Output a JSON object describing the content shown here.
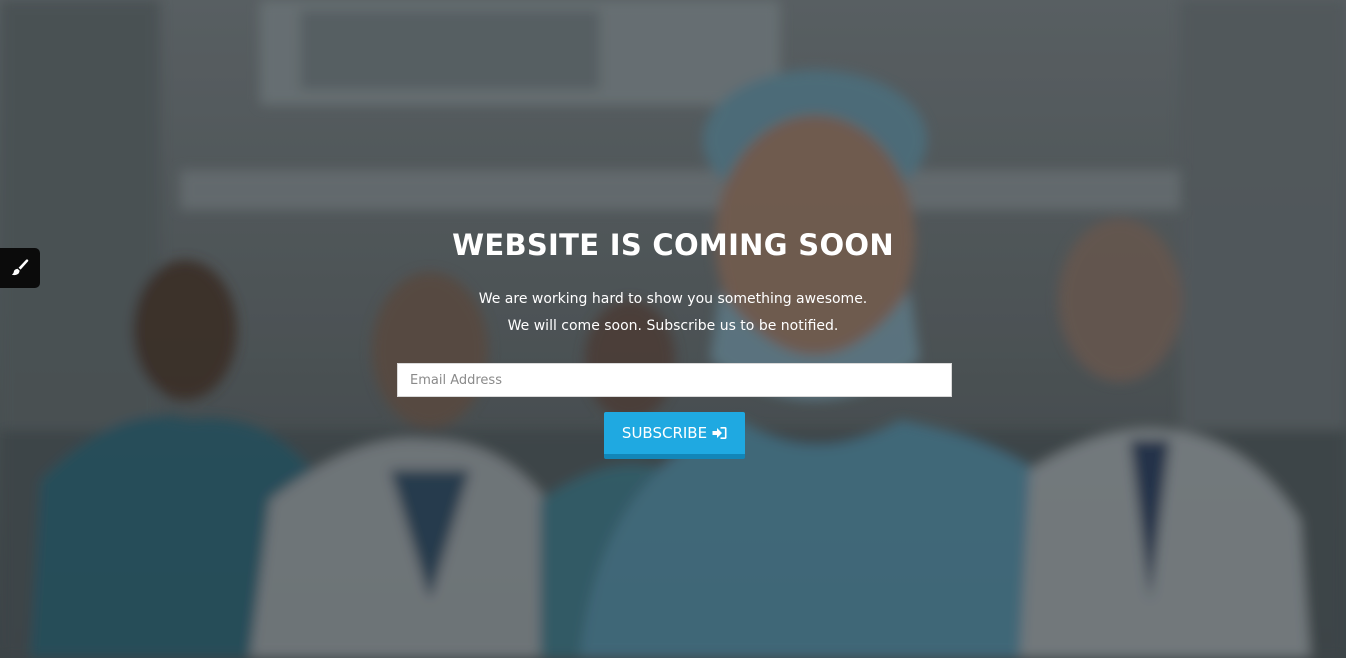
{
  "theme": {
    "accent": "#1fa9e1",
    "accent_dark": "#1286b8",
    "switcher_bg": "#0b0b0b",
    "text": "#ffffff"
  },
  "style_switcher": {
    "icon": "paintbrush-icon"
  },
  "hero": {
    "title": "WEBSITE IS COMING SOON",
    "line1": "We are working hard to show you something awesome.",
    "line2": "We will come soon. Subscribe us to be notified."
  },
  "subscribe_form": {
    "email_placeholder": "Email Address",
    "email_value": "",
    "button_label": "SUBSCRIBE",
    "button_icon": "sign-in-icon"
  }
}
